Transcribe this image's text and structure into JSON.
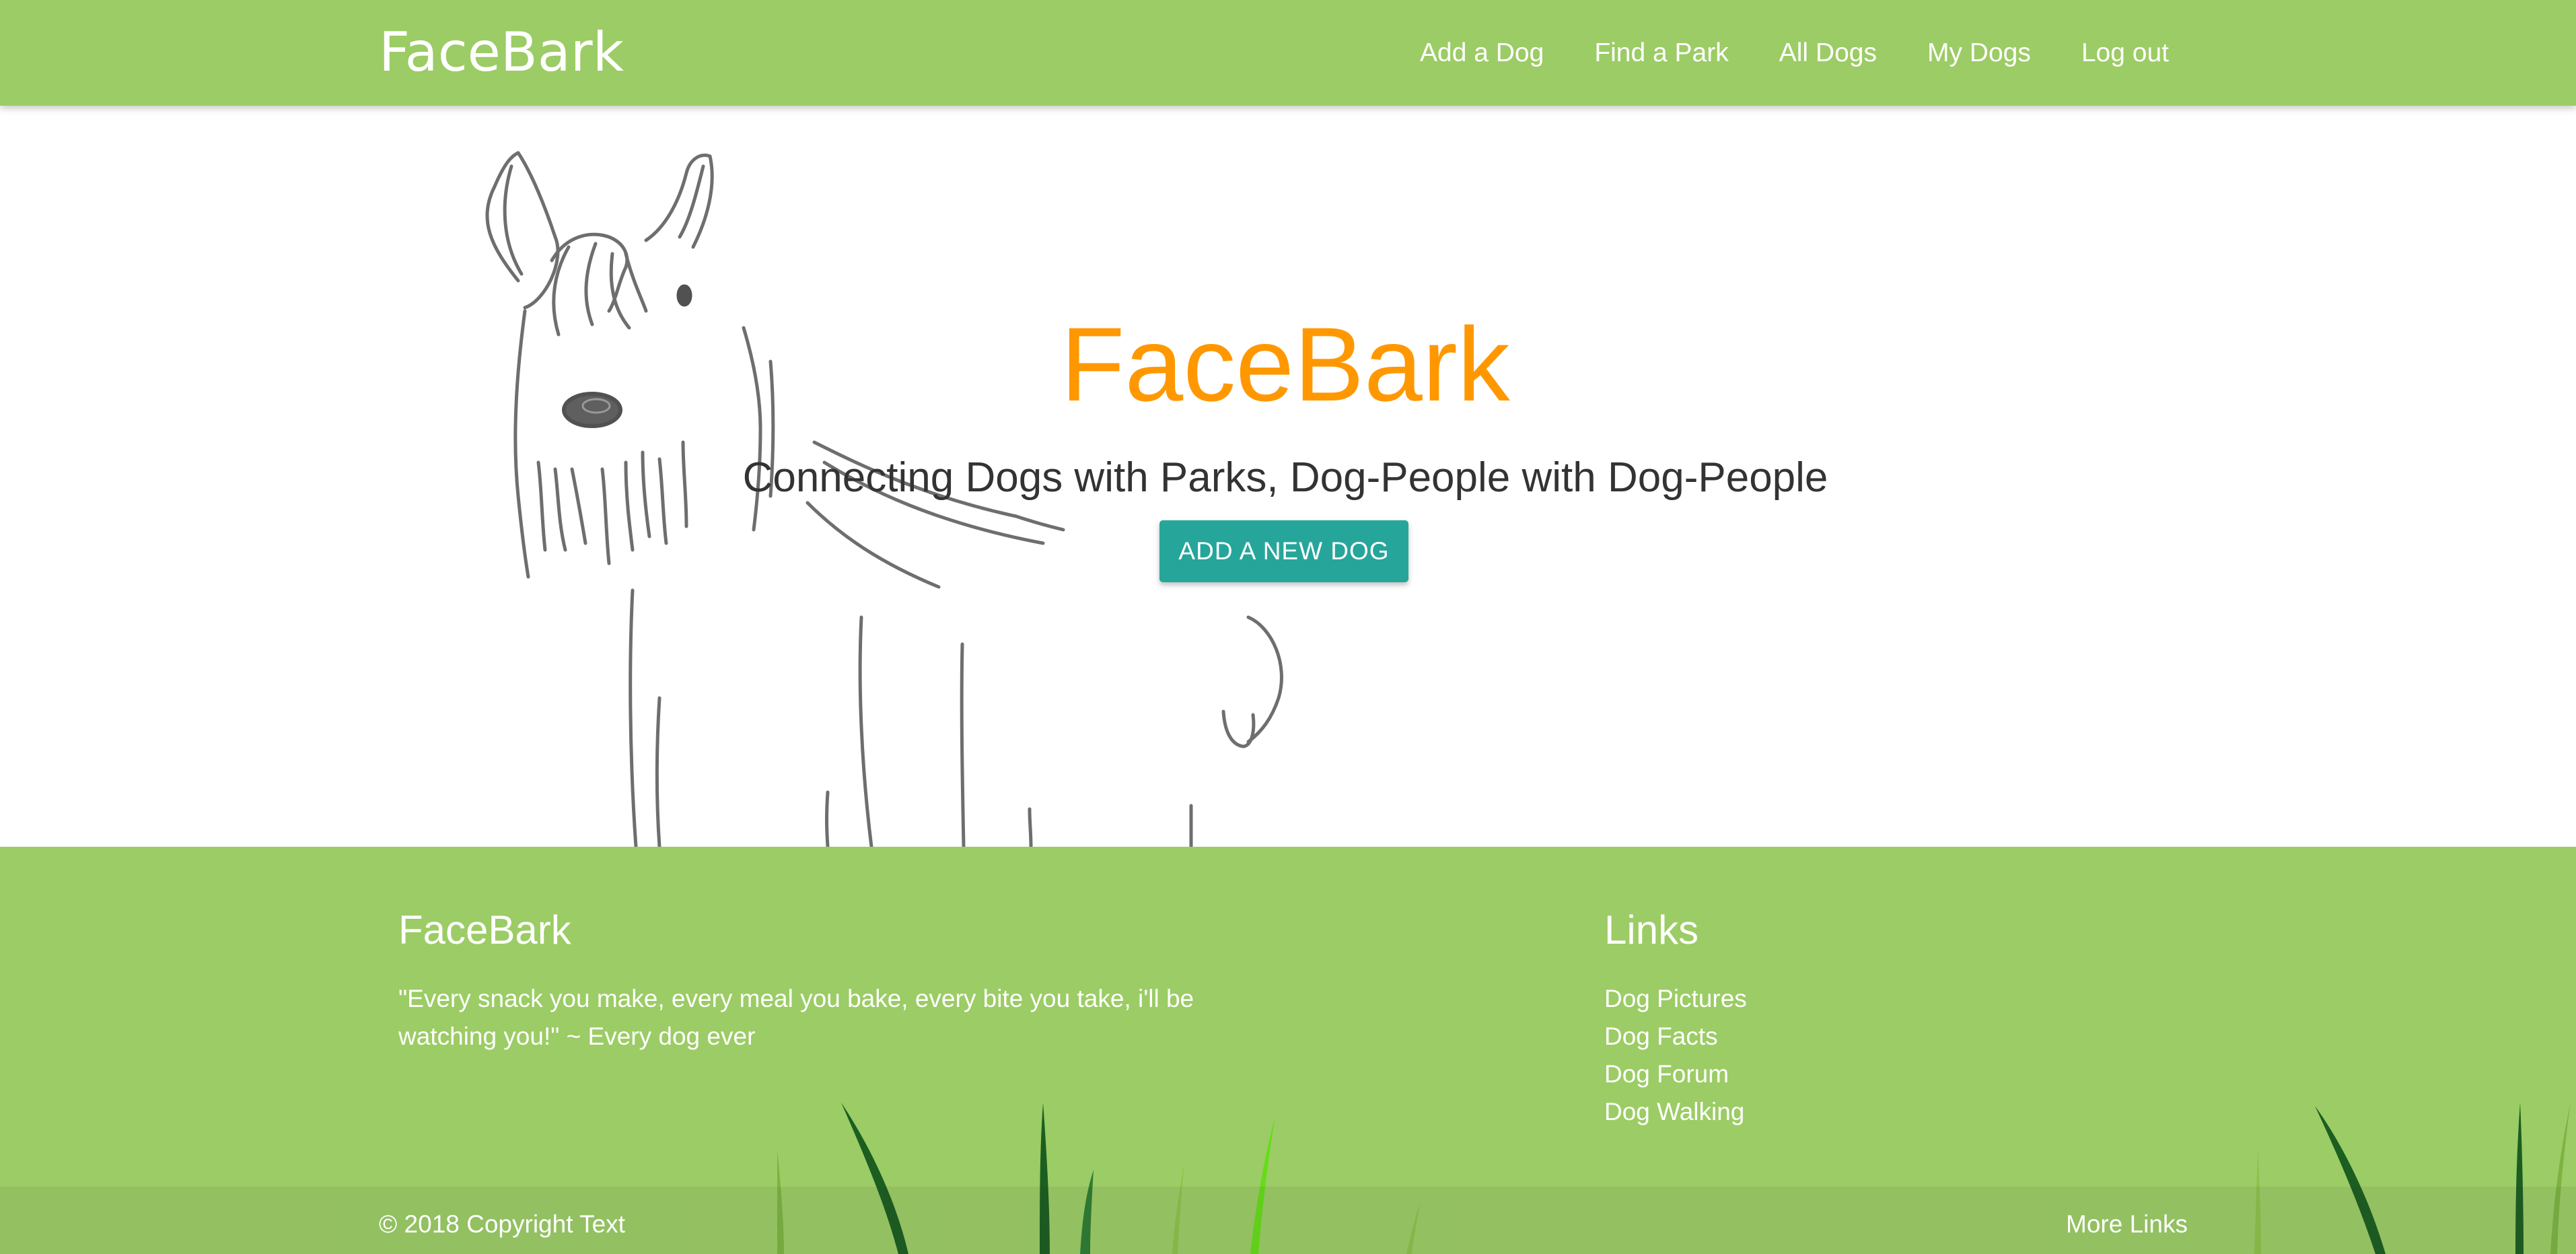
{
  "navbar": {
    "brand": "FaceBark",
    "links": [
      {
        "label": "Add a Dog"
      },
      {
        "label": "Find a Park"
      },
      {
        "label": "All Dogs"
      },
      {
        "label": "My Dogs"
      },
      {
        "label": "Log out"
      }
    ]
  },
  "hero": {
    "title": "FaceBark",
    "tagline": "Connecting Dogs with Parks, Dog-People with Dog-People",
    "button_label": "ADD A NEW DOG"
  },
  "footer": {
    "about_title": "FaceBark",
    "quote": "\"Every snack you make, every meal you bake, every bite you take, i'll be watching you!\" ~ Every dog ever",
    "links_title": "Links",
    "links": [
      {
        "label": "Dog Pictures"
      },
      {
        "label": "Dog Facts"
      },
      {
        "label": "Dog Forum"
      },
      {
        "label": "Dog Walking"
      }
    ],
    "copyright": "© 2018 Copyright Text",
    "more_links": "More Links"
  },
  "colors": {
    "primary_green": "#9ccc65",
    "accent_orange": "#ff9800",
    "button_teal": "#26a69a",
    "text_dark": "#333333"
  },
  "icons": {
    "hero_illustration": "dog-sketch",
    "footer_decoration": "grass-blades"
  }
}
